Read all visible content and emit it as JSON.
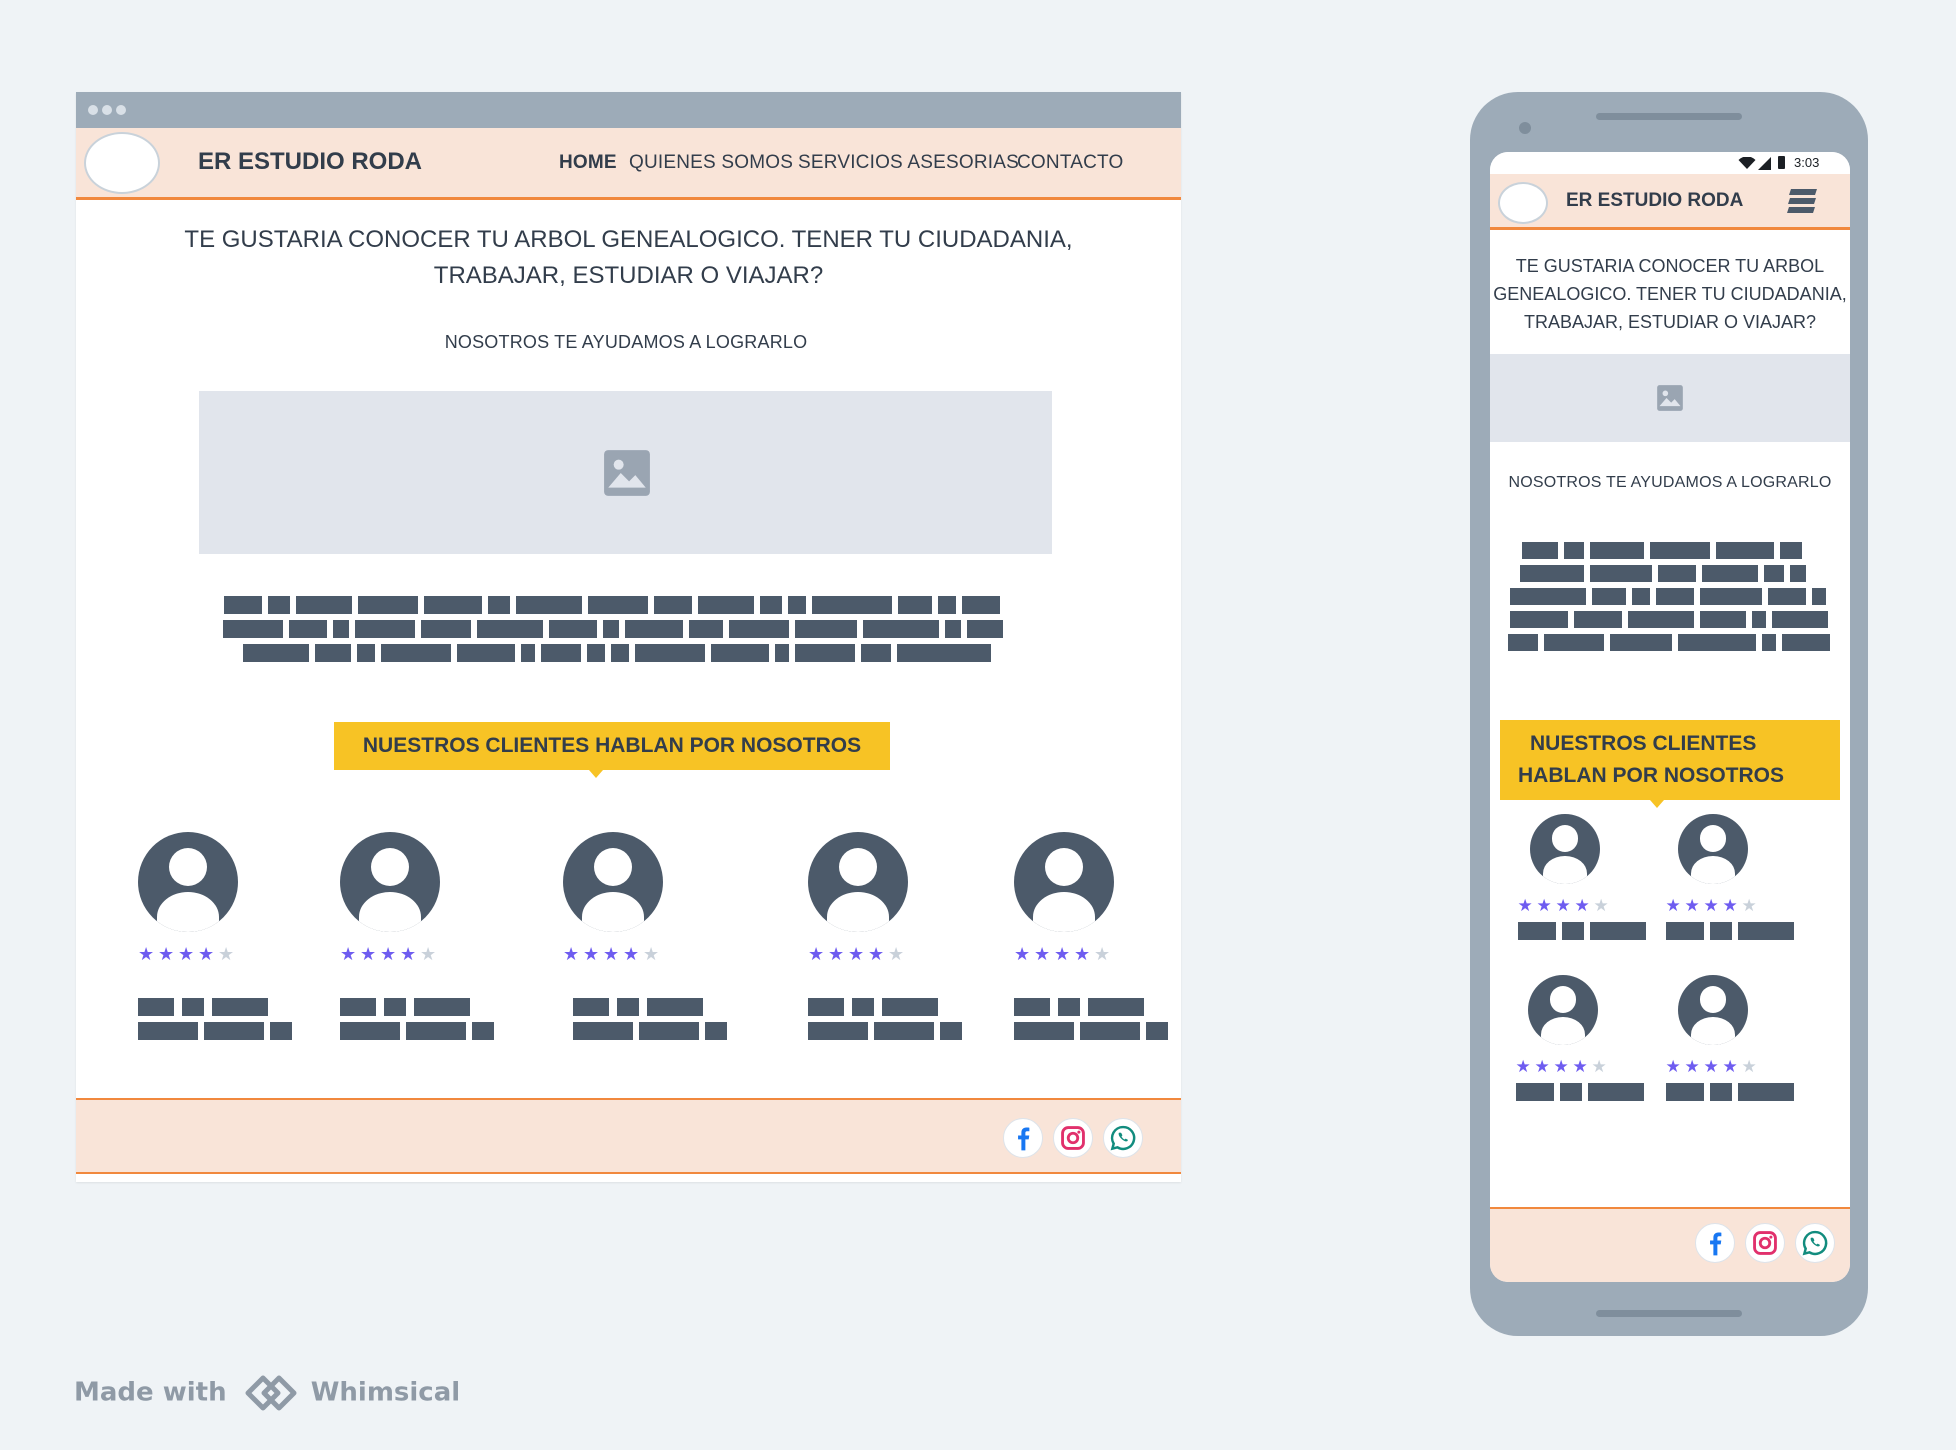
{
  "brand": "ER ESTUDIO RODA",
  "nav": {
    "items": [
      {
        "label": "HOME",
        "active": true
      },
      {
        "label": "QUIENES SOMOS",
        "active": false
      },
      {
        "label": "SERVICIOS ASESORIAS",
        "active": false
      },
      {
        "label": "CONTACTO",
        "active": false
      }
    ]
  },
  "hero": {
    "line1": "TE GUSTARIA CONOCER TU ARBOL GENEALOGICO. TENER TU CIUDADANIA,",
    "line2": "TRABAJAR, ESTUDIAR O VIAJAR?",
    "subtitle": "NOSOTROS TE AYUDAMOS  A LOGRARLO"
  },
  "mobile_hero": {
    "line1": "TE GUSTARIA CONOCER TU ARBOL",
    "line2": "GENEALOGICO. TENER TU CIUDADANIA,",
    "line3": "TRABAJAR, ESTUDIAR O VIAJAR?"
  },
  "testimonials": {
    "title": "NUESTROS CLIENTES HABLAN POR NOSOTROS",
    "mobile_title_line1": "NUESTROS CLIENTES",
    "mobile_title_line2": "HABLAN POR NOSOTROS",
    "rating": 4,
    "max_rating": 5,
    "desktop_count": 5,
    "mobile_count": 4
  },
  "social": [
    {
      "name": "facebook-icon",
      "color": "#1877f2"
    },
    {
      "name": "instagram-icon",
      "color": "#e1306c"
    },
    {
      "name": "whatsapp-icon",
      "color": "#128c7e"
    }
  ],
  "status_bar": {
    "time": "3:03"
  },
  "colors": {
    "nav_bg": "#f9e4d8",
    "accent_orange": "#f1883d",
    "callout_yellow": "#f7c325",
    "star_active": "#6e5cf0",
    "star_inactive": "#c9d1da",
    "placeholder_dark": "#4c5a6a",
    "frame_grey": "#9dabb8"
  },
  "footer_credit": {
    "prefix": "Made with",
    "app": "Whimsical"
  }
}
